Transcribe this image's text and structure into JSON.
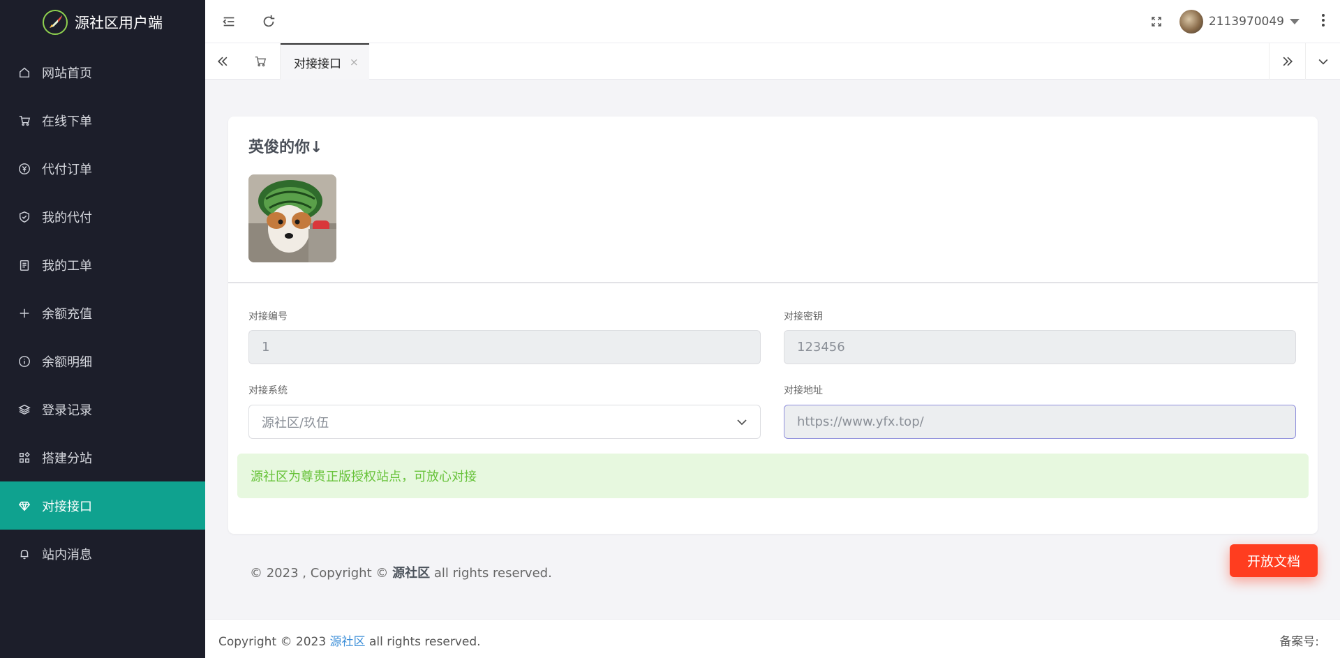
{
  "brand": {
    "name": "源社区用户端"
  },
  "sidebar": {
    "items": [
      {
        "label": "网站首页",
        "icon": "home-icon"
      },
      {
        "label": "在线下单",
        "icon": "cart-icon"
      },
      {
        "label": "代付订单",
        "icon": "yen-icon"
      },
      {
        "label": "我的代付",
        "icon": "shield-check-icon"
      },
      {
        "label": "我的工单",
        "icon": "clipboard-icon"
      },
      {
        "label": "余额充值",
        "icon": "plus-icon"
      },
      {
        "label": "余额明细",
        "icon": "info-icon"
      },
      {
        "label": "登录记录",
        "icon": "layers-icon"
      },
      {
        "label": "搭建分站",
        "icon": "apps-icon"
      },
      {
        "label": "对接接口",
        "icon": "diamond-icon",
        "active": true
      },
      {
        "label": "站内消息",
        "icon": "bell-icon"
      }
    ]
  },
  "header": {
    "username": "2113970049"
  },
  "tabs": {
    "active_label": "对接接口",
    "close_glyph": "×"
  },
  "card": {
    "title": "英俊的你↓",
    "fields": {
      "id_label": "对接编号",
      "id_value": "1",
      "key_label": "对接密钥",
      "key_value": "123456",
      "system_label": "对接系统",
      "system_value": "源社区/玖伍",
      "url_label": "对接地址",
      "url_value": "https://www.yfx.top/"
    },
    "notice": "源社区为尊贵正版授权站点，可放心对接"
  },
  "page_footer": {
    "prefix": "© 2023 , Copyright ©",
    "brand": "源社区",
    "suffix": "all rights reserved."
  },
  "doc_button": "开放文档",
  "bottom_footer": {
    "prefix": "Copyright © 2023",
    "link": "源社区",
    "suffix": "all rights reserved.",
    "record": "备案号:"
  },
  "colors": {
    "sidebar_bg": "#1c1e2a",
    "active_item": "#0fa28f",
    "notice_bg": "#e7f8df",
    "notice_text": "#67c23a",
    "doc_button": "#ff3d1f"
  }
}
